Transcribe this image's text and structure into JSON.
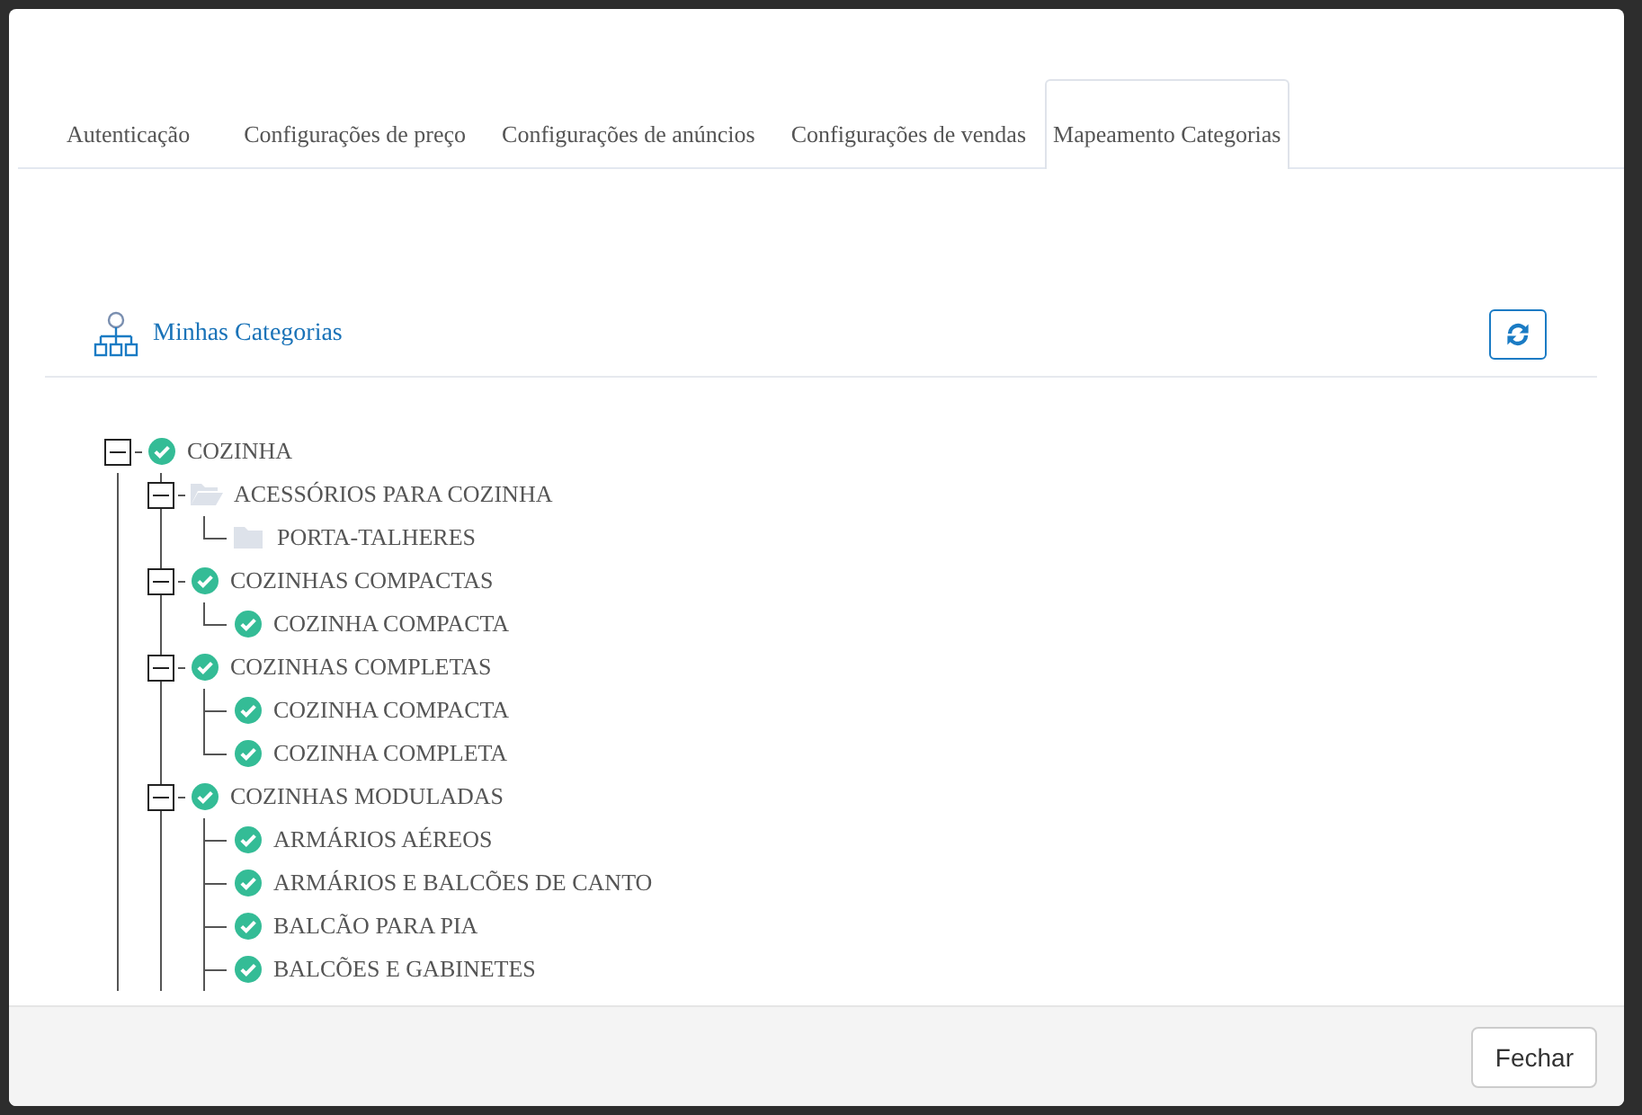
{
  "tabs": [
    {
      "label": "Autenticação",
      "selected": false
    },
    {
      "label": "Configurações de preço",
      "selected": false
    },
    {
      "label": "Configurações de anúncios",
      "selected": false
    },
    {
      "label": "Configurações de vendas",
      "selected": false
    },
    {
      "label": "Mapeamento Categorias",
      "selected": true
    }
  ],
  "panel": {
    "title": "Minhas Categorias"
  },
  "tree": [
    {
      "label": "COZINHA",
      "checked": true,
      "expanded": true,
      "children": [
        {
          "label": "ACESSÓRIOS PARA COZINHA",
          "checked": false,
          "expanded": true,
          "children": [
            {
              "label": "PORTA-TALHERES",
              "checked": false
            }
          ]
        },
        {
          "label": "COZINHAS COMPACTAS",
          "checked": true,
          "expanded": true,
          "children": [
            {
              "label": "COZINHA COMPACTA",
              "checked": true
            }
          ]
        },
        {
          "label": "COZINHAS COMPLETAS",
          "checked": true,
          "expanded": true,
          "children": [
            {
              "label": "COZINHA COMPACTA",
              "checked": true
            },
            {
              "label": "COZINHA COMPLETA",
              "checked": true
            }
          ]
        },
        {
          "label": "COZINHAS MODULADAS",
          "checked": true,
          "expanded": true,
          "children": [
            {
              "label": "ARMÁRIOS AÉREOS",
              "checked": true
            },
            {
              "label": "ARMÁRIOS E BALCÕES DE CANTO",
              "checked": true
            },
            {
              "label": "BALCÃO PARA PIA",
              "checked": true
            },
            {
              "label": "BALCÕES E GABINETES",
              "checked": true
            }
          ]
        }
      ]
    }
  ],
  "footer": {
    "close_button": "Fechar"
  }
}
